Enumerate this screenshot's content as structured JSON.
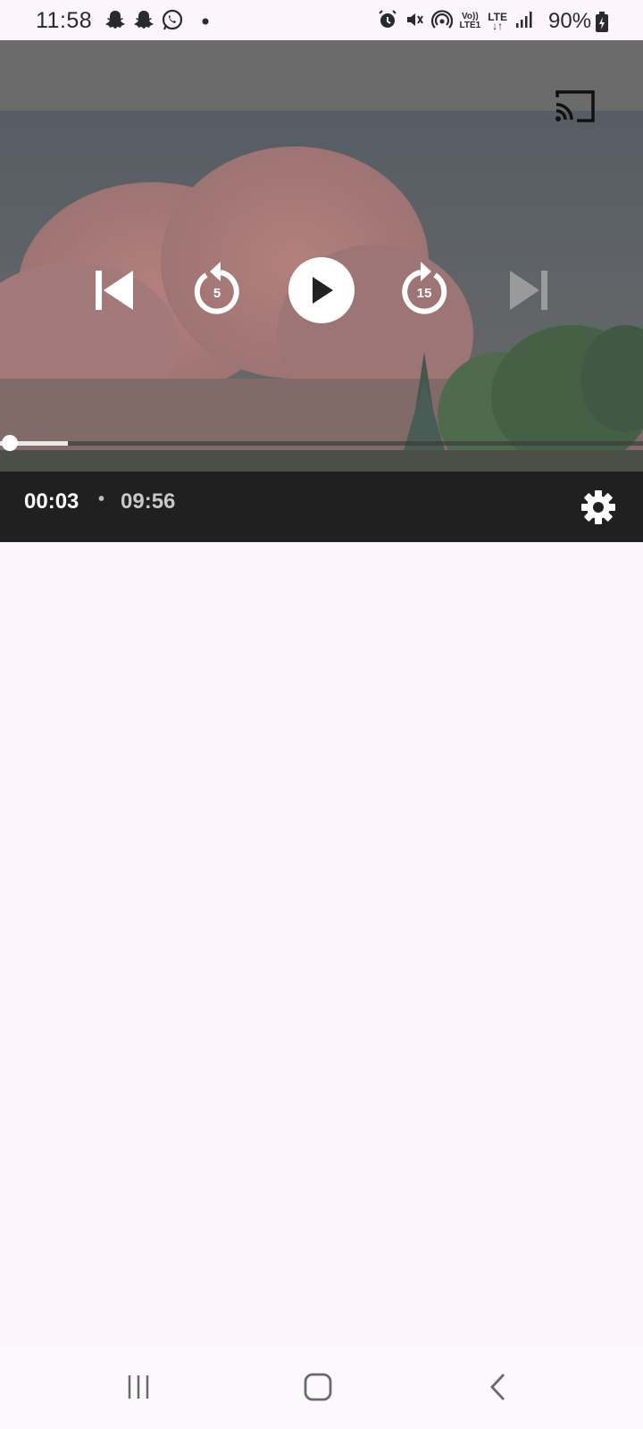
{
  "status_bar": {
    "time": "11:58",
    "battery": "90%",
    "network_volte": [
      "Vo))",
      "LTE1"
    ],
    "network_lte": "LTE",
    "left_icons": [
      "snapchat-icon",
      "snapchat-icon",
      "whatsapp-icon",
      "dot-icon"
    ],
    "right_icons": [
      "alarm-icon",
      "mute-icon",
      "hotspot-icon",
      "volte-icon",
      "lte-icon",
      "signal-icon",
      "battery-icon"
    ]
  },
  "player": {
    "skip_back_seconds": "5",
    "skip_forward_seconds": "15",
    "current_time": "00:03",
    "separator": "•",
    "total_time": "09:56",
    "progress_fraction": 0.005,
    "buffered_fraction": 0.105,
    "icons": [
      "cast-icon",
      "skip-previous-icon",
      "replay-5-icon",
      "play-icon",
      "forward-15-icon",
      "skip-next-icon",
      "settings-icon"
    ]
  },
  "nav_bar": {
    "icons": [
      "recent-apps-icon",
      "home-icon",
      "back-icon"
    ]
  },
  "colors": {
    "background": "#fcf5fc",
    "bottom_bar": "#202020",
    "control_white": "#ffffff",
    "next_disabled": "#9a9a9a"
  }
}
